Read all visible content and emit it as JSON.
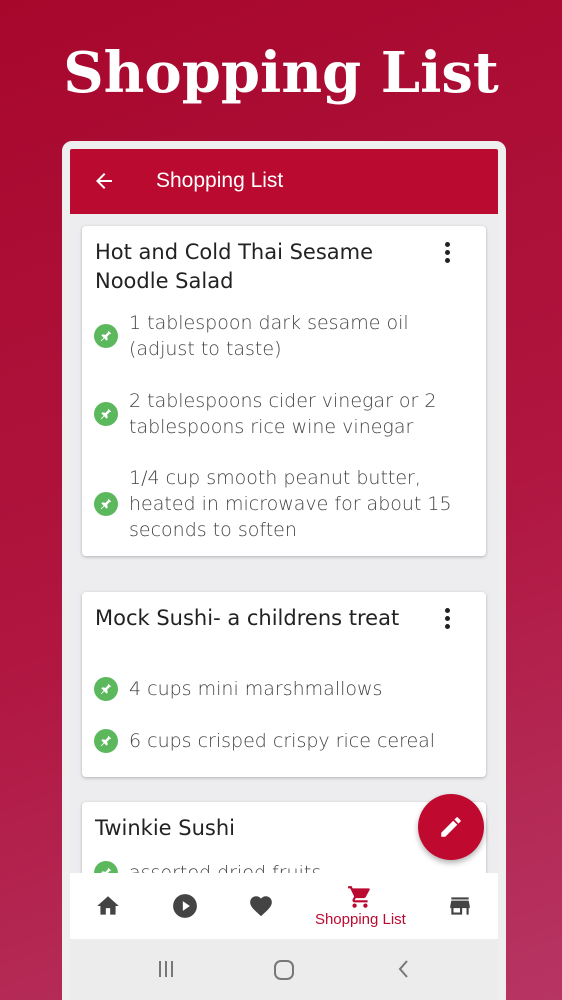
{
  "promo": {
    "title": "Shopping List"
  },
  "appbar": {
    "title": "Shopping List"
  },
  "cards": [
    {
      "title": "Hot  and Cold Thai Sesame Noodle Salad",
      "items": [
        "1 tablespoon dark sesame oil (adjust to taste)",
        "2 tablespoons cider vinegar or 2 tablespoons rice wine vinegar",
        "1/4 cup smooth peanut butter, heated in microwave for about 15 seconds to soften"
      ]
    },
    {
      "title": "Mock Sushi- a childrens treat",
      "items": [
        "4 cups mini marshmallows",
        "6 cups crisped crispy rice cereal"
      ]
    },
    {
      "title": "Twinkie Sushi",
      "items": [
        "assorted dried fruits"
      ]
    }
  ],
  "bottom_nav": {
    "items": [
      {
        "icon": "home-icon"
      },
      {
        "icon": "play-icon"
      },
      {
        "icon": "heart-icon"
      },
      {
        "icon": "cart-icon",
        "label": "Shopping List",
        "active": true
      },
      {
        "icon": "store-icon"
      }
    ]
  },
  "colors": {
    "primary": "#bb0a30",
    "check": "#5cb85c",
    "background_top": "#a8072c",
    "background_bottom": "#b73563"
  }
}
